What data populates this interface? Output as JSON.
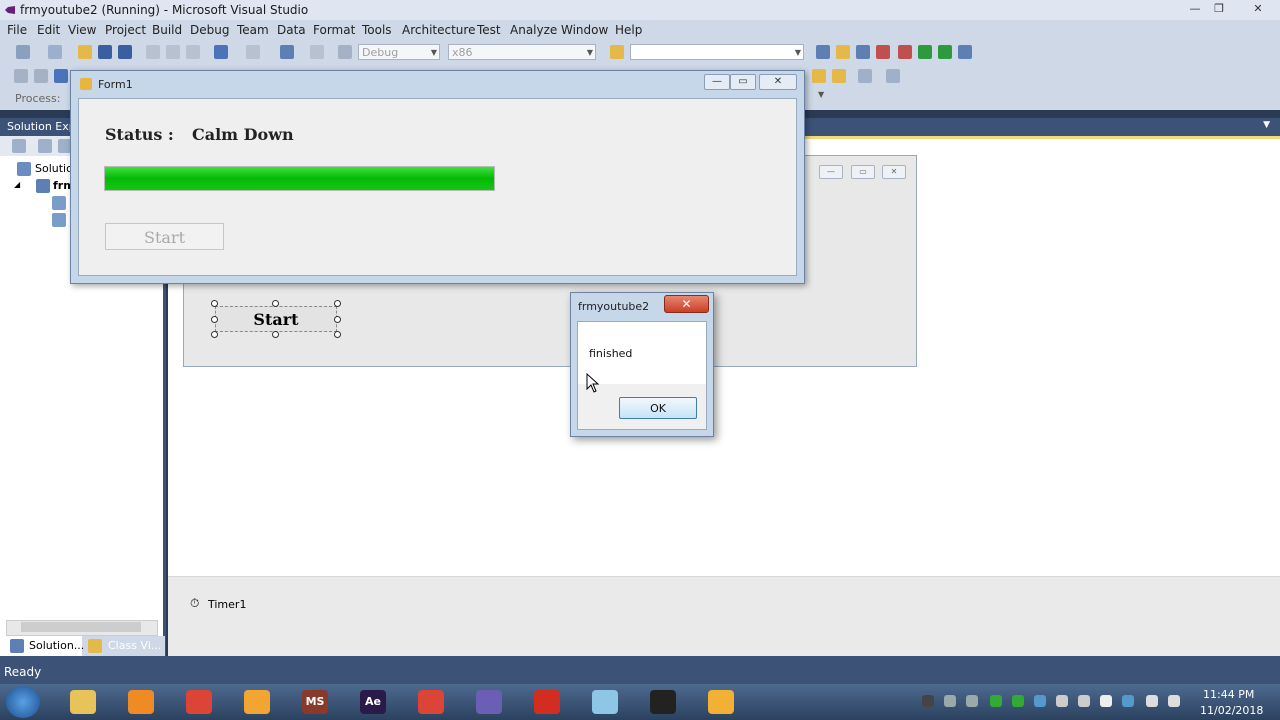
{
  "vs": {
    "title": "frmyoutube2 (Running) - Microsoft Visual Studio",
    "menu": [
      "File",
      "Edit",
      "View",
      "Project",
      "Build",
      "Debug",
      "Team",
      "Data",
      "Format",
      "Tools",
      "Architecture",
      "Test",
      "Analyze",
      "Window",
      "Help"
    ],
    "toolbar": {
      "config_combo": "Debug",
      "platform_combo": "x86",
      "process_label": "Process:"
    },
    "solution_panel": {
      "header": "Solution Expl",
      "tree_root": "Solutio",
      "tree_project": "frm",
      "tabs": [
        "Solution...",
        "Class Vi..."
      ]
    },
    "tray": {
      "timer_label": "Timer1"
    },
    "designer": {
      "start_label": "Start"
    },
    "status": "Ready"
  },
  "form1": {
    "title": "Form1",
    "status_label": "Status :",
    "status_value": "Calm Down",
    "progress_fraction": 1.0,
    "start_label": "Start"
  },
  "msgbox": {
    "title": "frmyoutube2",
    "close_glyph": "✕",
    "message": "finished",
    "ok_label": "OK"
  },
  "taskbar": {
    "apps": [
      {
        "name": "explorer",
        "color": "#e8c35a"
      },
      {
        "name": "media-player",
        "color": "#f08a24"
      },
      {
        "name": "chrome",
        "color": "#db4437"
      },
      {
        "name": "sublime",
        "color": "#f3a534"
      },
      {
        "name": "ms-project",
        "color": "#8a3a2a",
        "label": "MS"
      },
      {
        "name": "after-effects",
        "color": "#2a1a4a",
        "label": "Ae"
      },
      {
        "name": "chrome-2",
        "color": "#db4437"
      },
      {
        "name": "visual-studio",
        "color": "#6a5fb5"
      },
      {
        "name": "acrobat",
        "color": "#d22d20"
      },
      {
        "name": "notepad",
        "color": "#8ec6e6"
      },
      {
        "name": "obs",
        "color": "#222222"
      },
      {
        "name": "winforms-app",
        "color": "#f2b035"
      }
    ],
    "clock_time": "11:44 PM",
    "clock_date": "11/02/2018"
  }
}
